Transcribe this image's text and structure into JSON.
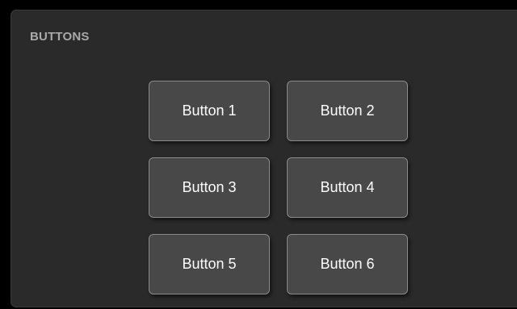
{
  "panel": {
    "title": "BUTTONS"
  },
  "buttons": [
    {
      "label": "Button 1"
    },
    {
      "label": "Button 2"
    },
    {
      "label": "Button 3"
    },
    {
      "label": "Button 4"
    },
    {
      "label": "Button 5"
    },
    {
      "label": "Button 6"
    }
  ],
  "colors": {
    "page_background": "#000000",
    "panel_background": "#2a2a2a",
    "button_background": "#484848",
    "button_border": "#8a8a8a",
    "title_text": "#a9a9a9",
    "button_text": "#ffffff"
  }
}
